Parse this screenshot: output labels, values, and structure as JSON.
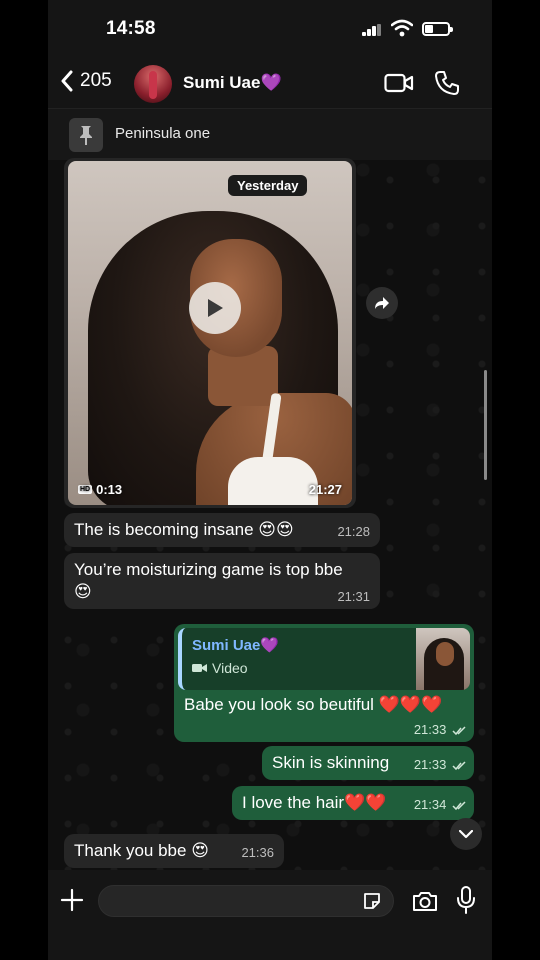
{
  "status_bar": {
    "time": "14:58"
  },
  "header": {
    "back_count": "205",
    "contact_name": "Sumi Uae💜"
  },
  "pinned": {
    "text": "Peninsula one"
  },
  "video_message": {
    "date_chip": "Yesterday",
    "duration": "0:13",
    "hd_badge": "HD",
    "time": "21:27"
  },
  "messages": [
    {
      "direction": "in",
      "text": "The is becoming insane 😍😍",
      "time": "21:28"
    },
    {
      "direction": "in",
      "text": "You’re moisturizing game is top bbe",
      "emoji_line": "😍",
      "time": "21:31"
    },
    {
      "direction": "out",
      "reply": {
        "name": "Sumi Uae💜",
        "type": "Video"
      },
      "text": "Babe you look so beutiful ❤️❤️❤️",
      "time": "21:33"
    },
    {
      "direction": "out",
      "text": "Skin is skinning",
      "time": "21:33"
    },
    {
      "direction": "out",
      "text": "I love the hair❤️❤️",
      "time": "21:34"
    },
    {
      "direction": "in",
      "text": "Thank you bbe 😍",
      "time": "21:36"
    }
  ],
  "icons": {
    "back": "chevron-left-icon",
    "video_call": "video-camera-icon",
    "voice_call": "phone-icon",
    "pin": "pin-icon",
    "play": "play-icon",
    "forward": "forward-icon",
    "scroll_down": "chevron-down-icon",
    "attach": "plus-icon",
    "sticker": "sticker-icon",
    "camera": "camera-icon",
    "mic": "microphone-icon"
  },
  "colors": {
    "incoming_bubble": "#262626",
    "outgoing_bubble": "#1f5e3b",
    "reply_name": "#7fb7ff"
  }
}
